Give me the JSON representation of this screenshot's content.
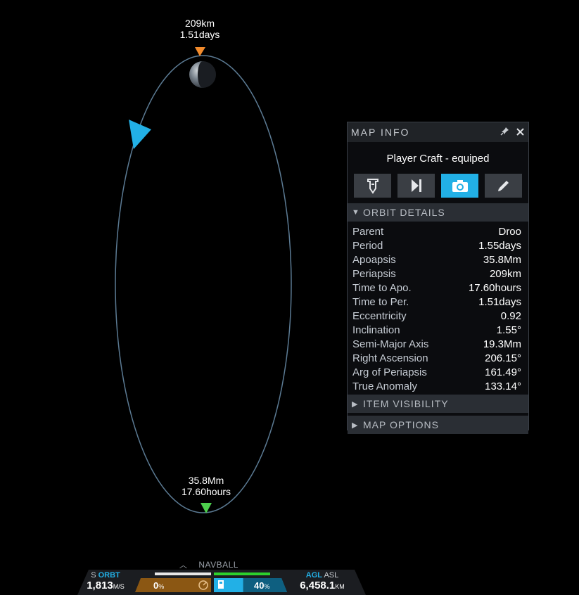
{
  "map": {
    "top_marker": {
      "distance": "209km",
      "time": "1.51days",
      "color": "#f28b2c"
    },
    "bottom_marker": {
      "distance": "35.8Mm",
      "time": "17.60hours",
      "color": "#4ccf4c"
    },
    "craft_color": "#22b0e6",
    "orbit_color": "#5b7a93"
  },
  "panel": {
    "title": "MAP INFO",
    "pin_icon": "pin-icon",
    "close_icon": "close-icon",
    "craft_name": "Player Craft - equiped",
    "buttons": [
      {
        "name": "craft-button",
        "icon": "craft-icon"
      },
      {
        "name": "skip-button",
        "icon": "skip-forward-icon"
      },
      {
        "name": "camera-button",
        "icon": "camera-icon",
        "active": true
      },
      {
        "name": "edit-button",
        "icon": "pencil-icon"
      }
    ],
    "sections": {
      "orbit": "ORBIT DETAILS",
      "items": "ITEM VISIBILITY",
      "options": "MAP OPTIONS"
    },
    "details": [
      {
        "label": "Parent",
        "value": "Droo"
      },
      {
        "label": "Period",
        "value": "1.55days"
      },
      {
        "label": "Apoapsis",
        "value": "35.8Mm"
      },
      {
        "label": "Periapsis",
        "value": "209km"
      },
      {
        "label": "Time to Apo.",
        "value": "17.60hours"
      },
      {
        "label": "Time to Per.",
        "value": "1.51days"
      },
      {
        "label": "Eccentricity",
        "value": "0.92"
      },
      {
        "label": "Inclination",
        "value": "1.55°"
      },
      {
        "label": "Semi-Major Axis",
        "value": "19.3Mm"
      },
      {
        "label": "Right Ascension",
        "value": "206.15°"
      },
      {
        "label": "Arg of Periapsis",
        "value": "161.49°"
      },
      {
        "label": "True Anomaly",
        "value": "133.14°"
      }
    ]
  },
  "hud": {
    "navball": "NAVBALL",
    "speed_mode_s": "S",
    "speed_mode": "ORBT",
    "speed_value": "1,813",
    "speed_unit": "M/S",
    "throttle_value": "0",
    "throttle_unit": "%",
    "fuel_value": "40",
    "fuel_unit": "%",
    "fuel_fraction": 0.4,
    "alt_mode_active": "AGL",
    "alt_mode_other": "ASL",
    "alt_value": "6,458.1",
    "alt_unit": "KM"
  }
}
